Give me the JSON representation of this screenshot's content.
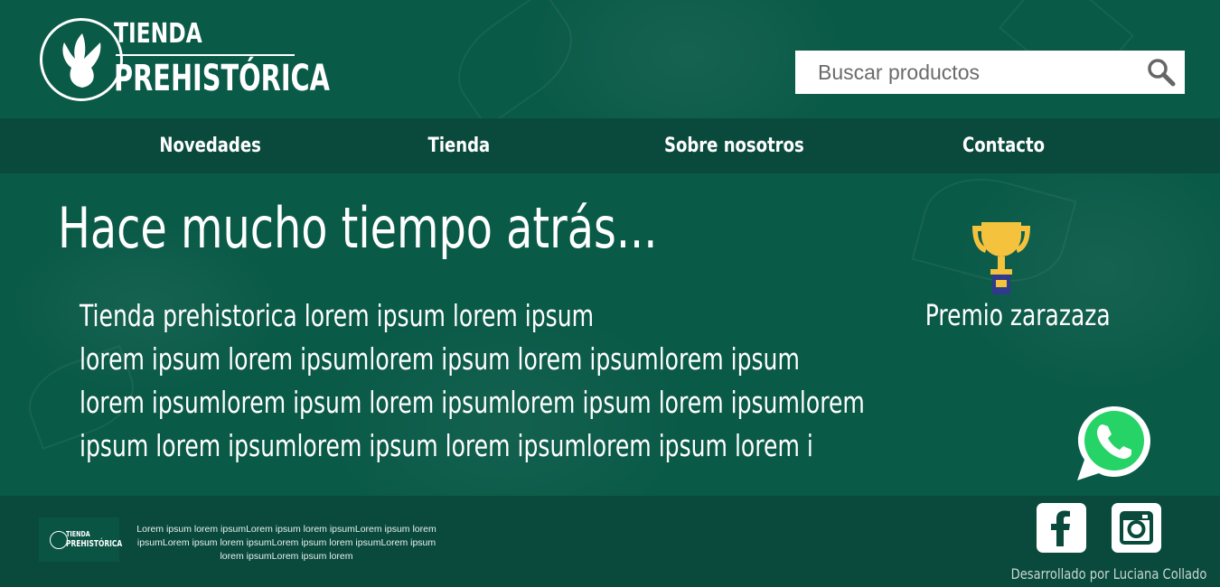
{
  "brand": {
    "line1": "TIENDA",
    "line2": "PREHISTÓRICA"
  },
  "search": {
    "placeholder": "Buscar productos"
  },
  "nav": {
    "items": [
      {
        "label": "Novedades"
      },
      {
        "label": "Tienda"
      },
      {
        "label": "Sobre nosotros"
      },
      {
        "label": "Contacto"
      }
    ]
  },
  "main": {
    "headline": "Hace mucho tiempo atrás...",
    "paragraph_lines": [
      "Tienda prehistorica lorem ipsum lorem ipsum",
      "lorem ipsum lorem ipsumlorem ipsum lorem ipsumlorem ipsum",
      "lorem ipsumlorem ipsum lorem ipsumlorem ipsum lorem ipsumlorem",
      "ipsum lorem ipsumlorem ipsum lorem ipsumlorem ipsum lorem i"
    ]
  },
  "award": {
    "label": "Premio zarazaza"
  },
  "footer": {
    "brand_line1": "TIENDA",
    "brand_line2": "PREHISTÓRICA",
    "text": "Lorem ipsum lorem ipsumLorem ipsum lorem ipsumLorem ipsum lorem ipsumLorem ipsum lorem ipsumLorem ipsum lorem ipsumLorem ipsum lorem ipsumLorem ipsum lorem",
    "credit": "Desarrollado por Luciana Collado"
  },
  "icons": {
    "search": "search-icon",
    "award": "trophy-icon",
    "chat": "whatsapp-icon",
    "social": [
      "facebook-icon",
      "instagram-icon"
    ]
  },
  "colors": {
    "background": "#0a5a48",
    "bar": "#0a4a3d",
    "trophy": "#f5c23e",
    "whatsapp": "#25d366"
  }
}
